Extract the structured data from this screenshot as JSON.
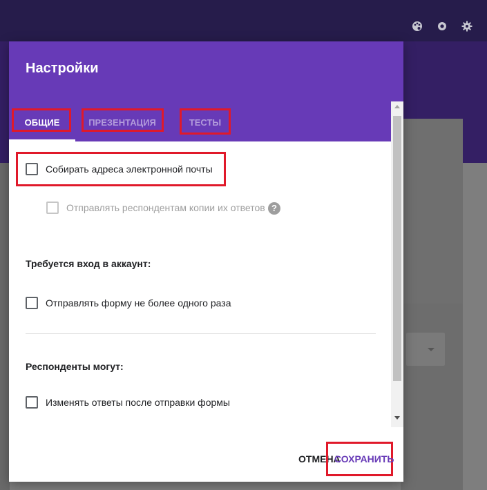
{
  "dialog": {
    "title": "Настройки",
    "tabs": [
      {
        "label": "ОБЩИЕ",
        "active": true
      },
      {
        "label": "ПРЕЗЕНТАЦИЯ",
        "active": false
      },
      {
        "label": "ТЕСТЫ",
        "active": false
      }
    ],
    "options": {
      "collect_emails": {
        "label": "Собирать адреса электронной почты",
        "checked": false
      },
      "send_copies": {
        "label": "Отправлять респондентам копии их ответов",
        "checked": false,
        "disabled": true,
        "help": "?"
      },
      "signin_heading": "Требуется вход в аккаунт:",
      "limit_one": {
        "label": "Отправлять форму не более одного раза",
        "checked": false
      },
      "respondents_heading": "Респонденты могут:",
      "edit_after": {
        "label": "Изменять ответы после отправки формы",
        "checked": false
      }
    },
    "buttons": {
      "cancel": "ОТМЕНА",
      "save": "СОХРАНИТЬ"
    }
  },
  "toolbar_icons": [
    "palette-icon",
    "preview-eye-icon",
    "settings-gear-icon"
  ],
  "colors": {
    "header": "#673ab7",
    "topbar": "#261c4b",
    "highlight": "#e0192a",
    "save_text": "#673ab7"
  }
}
